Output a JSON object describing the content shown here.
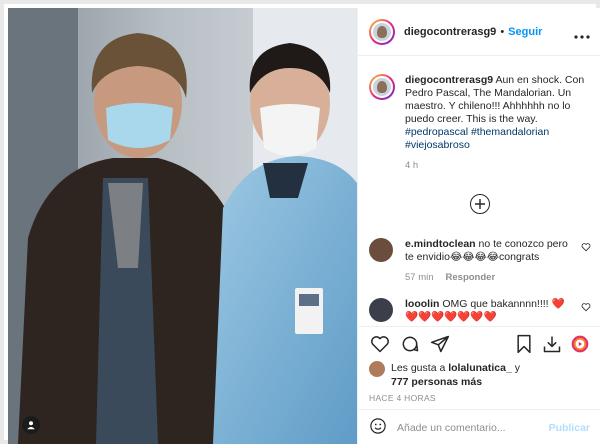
{
  "post": {
    "username": "diegocontrerasg9",
    "follow_label": "Seguir",
    "dot": "•"
  },
  "caption": {
    "username": "diegocontrerasg9",
    "text": "Aun en shock. Con Pedro Pascal, The Mandalorian. Un maestro. Y chileno!!! Ahhhhhh no lo puedo creer. This is the way.",
    "hashtags": "#pedropascal #themandalorian #viejosabroso",
    "time": "4 h"
  },
  "comments": [
    {
      "username": "e.mindtoclean",
      "text": "no te conozco pero te envidio😂😂😂😂congrats",
      "time": "57 min",
      "reply_label": "Responder"
    },
    {
      "username": "looolin",
      "text": "OMG que bakannnn!!!! ❤️❤️❤️❤️❤️❤️❤️❤️"
    }
  ],
  "likes": {
    "prefix": "Les gusta a",
    "user": "lolalunatica_",
    "conj": "y",
    "count": "777 personas más"
  },
  "timestamp": "HACE 4 HORAS",
  "add_comment": {
    "placeholder": "Añade un comentario...",
    "publish_label": "Publicar"
  },
  "colors": {
    "link_blue": "#0095f6",
    "publish_disabled": "#b2dffc",
    "hashtag": "#00376b",
    "muted": "#8e8e8e"
  },
  "icons": [
    "more-icon",
    "plus-circle-icon",
    "heart-icon",
    "comment-icon",
    "share-icon",
    "bookmark-icon",
    "download-icon",
    "reel-icon",
    "emoji-icon",
    "user-tag-icon"
  ]
}
